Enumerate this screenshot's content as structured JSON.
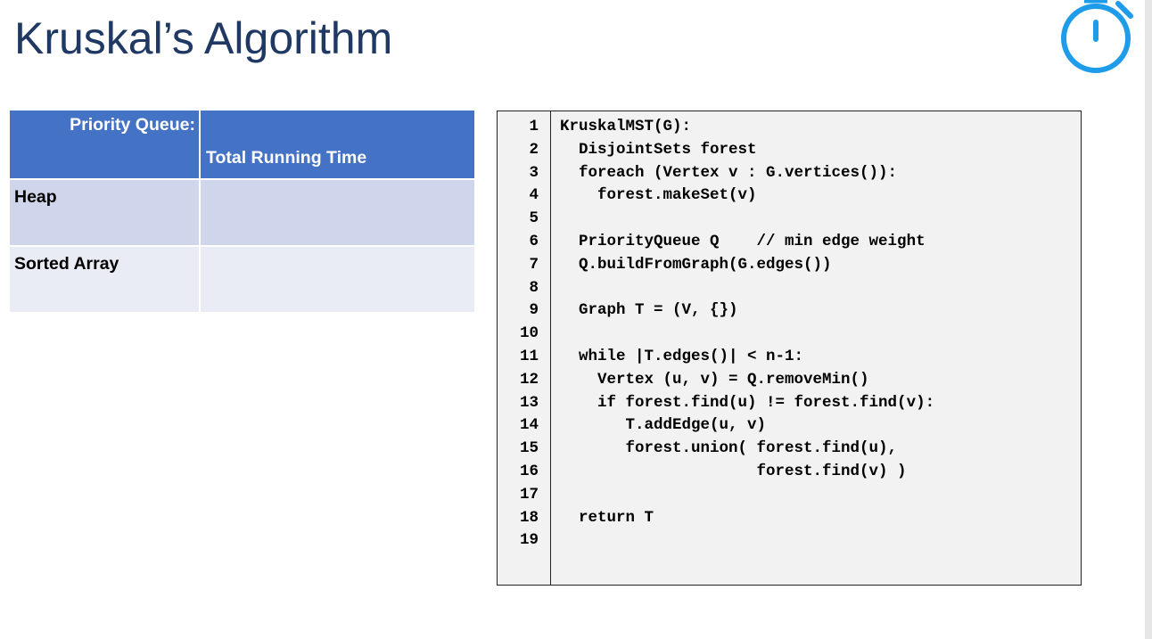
{
  "slide": {
    "title": "Kruskal’s Algorithm"
  },
  "icons": {
    "timer": "stopwatch-icon",
    "accent_color": "#1e9be9"
  },
  "table": {
    "header": {
      "col1": "Priority Queue:",
      "col2": "Total Running Time"
    },
    "rows": [
      {
        "label": "Heap",
        "value": ""
      },
      {
        "label": "Sorted Array",
        "value": ""
      }
    ]
  },
  "code": {
    "lines": [
      {
        "num": "1",
        "text": "KruskalMST(G):"
      },
      {
        "num": "2",
        "text": "  DisjointSets forest"
      },
      {
        "num": "3",
        "text": "  foreach (Vertex v : G.vertices()):"
      },
      {
        "num": "4",
        "text": "    forest.makeSet(v)"
      },
      {
        "num": "5",
        "text": ""
      },
      {
        "num": "6",
        "text": "  PriorityQueue Q    // min edge weight"
      },
      {
        "num": "7",
        "text": "  Q.buildFromGraph(G.edges())"
      },
      {
        "num": "8",
        "text": ""
      },
      {
        "num": "9",
        "text": "  Graph T = (V, {})"
      },
      {
        "num": "10",
        "text": ""
      },
      {
        "num": "11",
        "text": "  while |T.edges()| < n-1:"
      },
      {
        "num": "12",
        "text": "    Vertex (u, v) = Q.removeMin()"
      },
      {
        "num": "13",
        "text": "    if forest.find(u) != forest.find(v):"
      },
      {
        "num": "14",
        "text": "       T.addEdge(u, v)"
      },
      {
        "num": "15",
        "text": "       forest.union( forest.find(u),"
      },
      {
        "num": "16",
        "text": "                     forest.find(v) )"
      },
      {
        "num": "17",
        "text": ""
      },
      {
        "num": "18",
        "text": "  return T"
      },
      {
        "num": "19",
        "text": ""
      }
    ]
  }
}
